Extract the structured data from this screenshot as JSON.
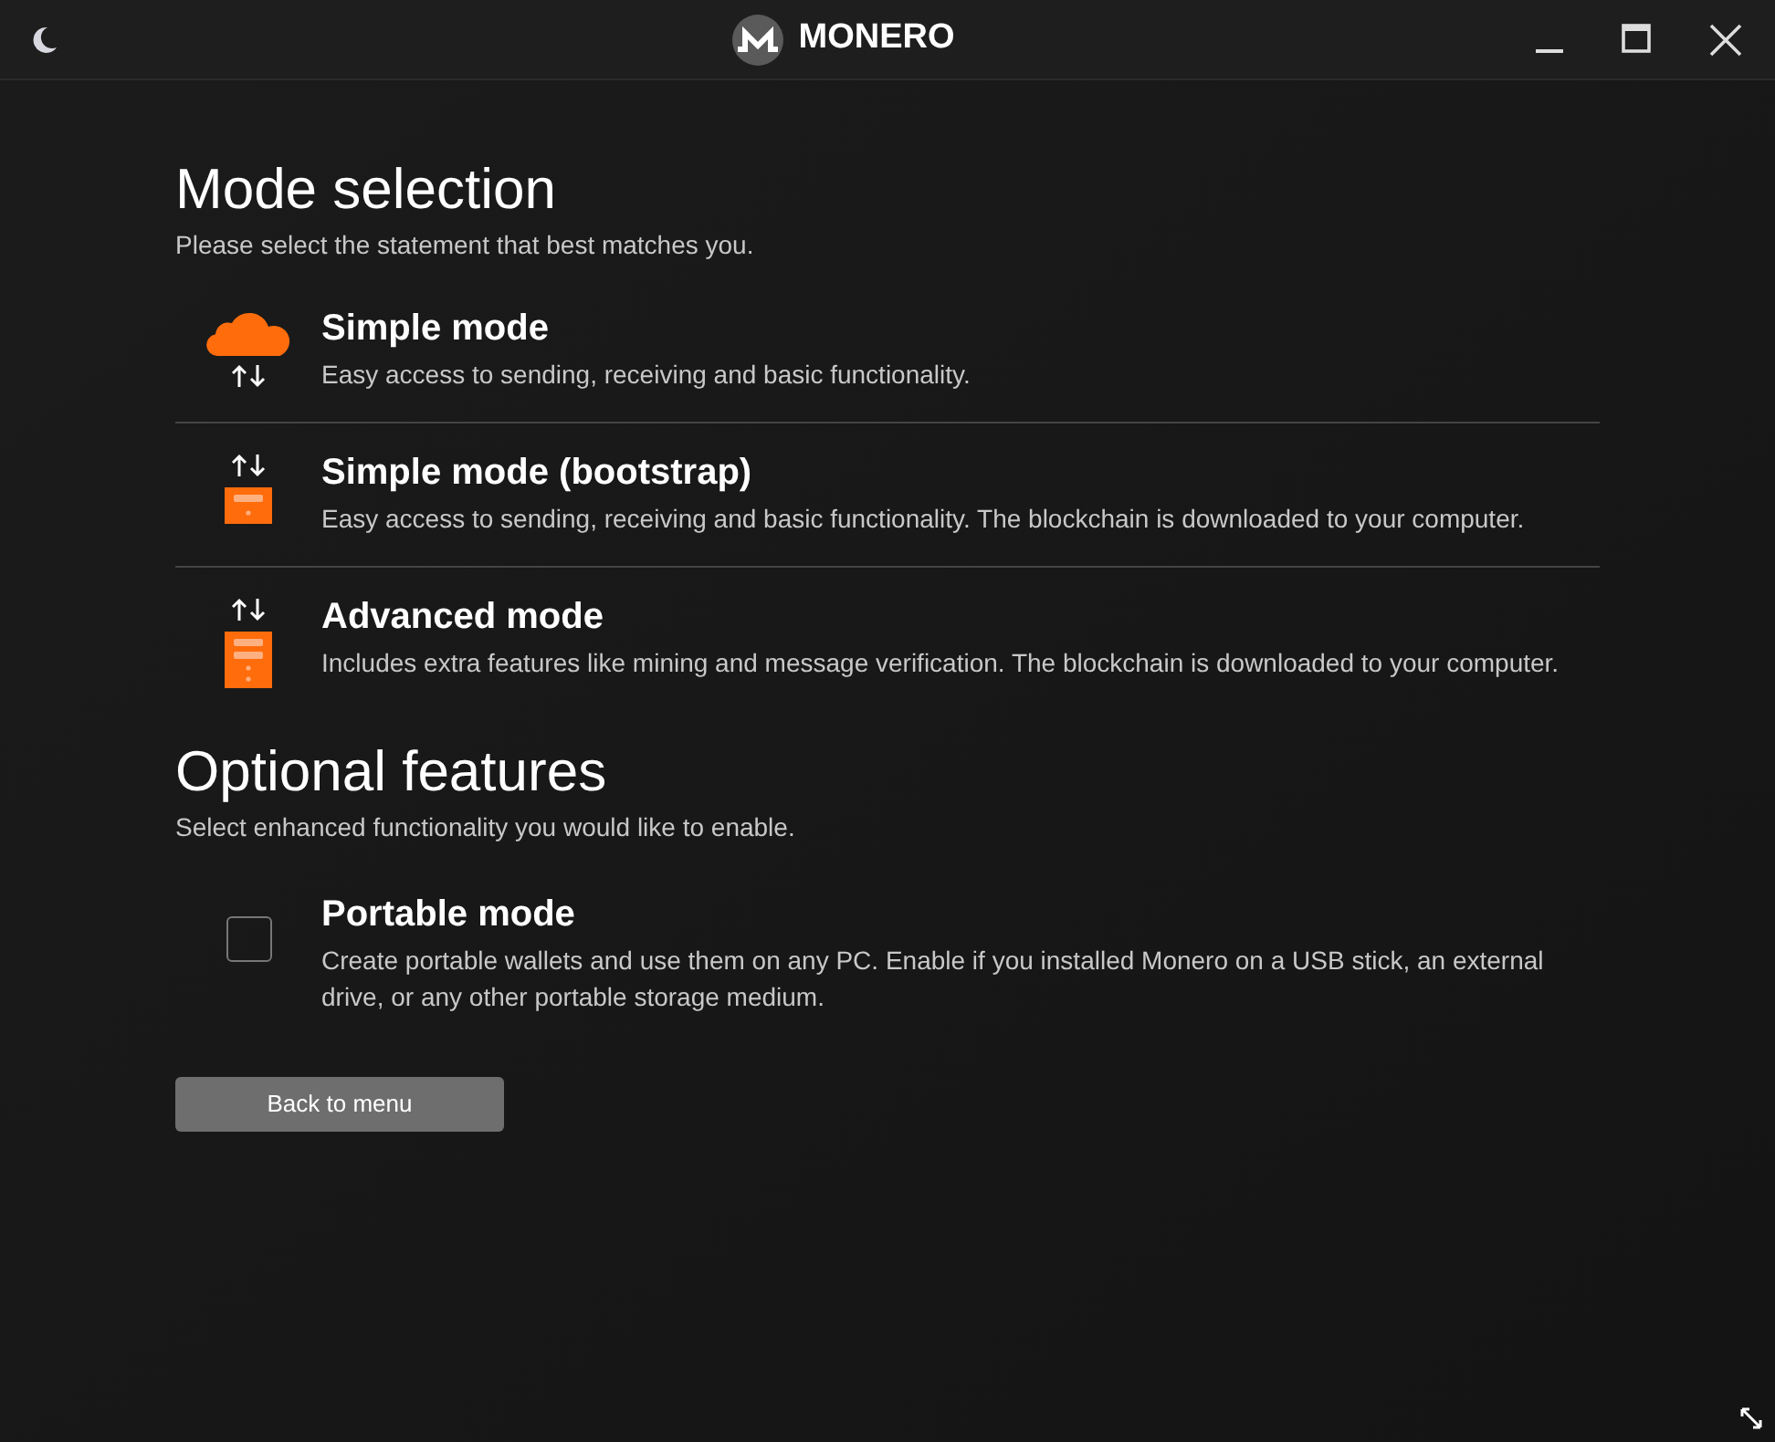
{
  "window": {
    "title": "MONERO"
  },
  "mode_selection": {
    "title": "Mode selection",
    "subtitle": "Please select the statement that best matches you.",
    "modes": [
      {
        "kind": "cloud",
        "title": "Simple mode",
        "description": "Easy access to sending, receiving and basic functionality."
      },
      {
        "kind": "bootstrap",
        "title": "Simple mode (bootstrap)",
        "description": "Easy access to sending, receiving and basic functionality. The blockchain is downloaded to your computer."
      },
      {
        "kind": "advanced",
        "title": "Advanced mode",
        "description": "Includes extra features like mining and message verification. The blockchain is downloaded to your computer."
      }
    ]
  },
  "optional_features": {
    "title": "Optional features",
    "subtitle": "Select enhanced functionality you would like to enable.",
    "features": [
      {
        "title": "Portable mode",
        "description": "Create portable wallets and use them on any PC. Enable if you installed Monero on a USB stick, an external drive, or any other portable storage medium.",
        "checked": false
      }
    ]
  },
  "back_button": "Back to menu"
}
